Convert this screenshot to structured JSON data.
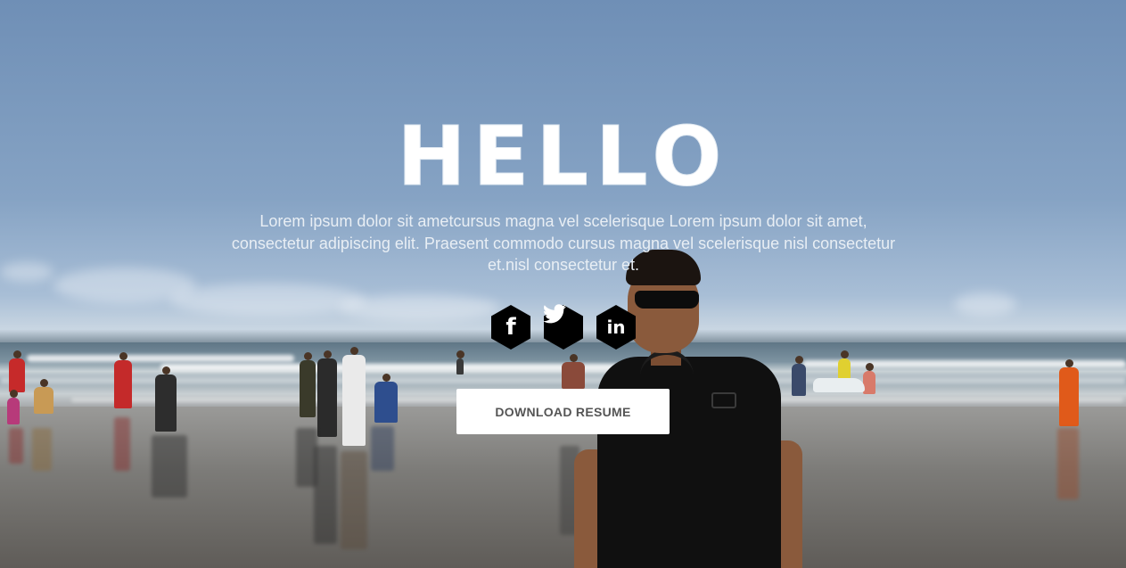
{
  "hero": {
    "heading": "HELLO",
    "intro_text": "Lorem ipsum dolor sit ametcursus magna vel scelerisque Lorem ipsum dolor sit amet, consectetur adipiscing elit. Praesent commodo cursus magna vel scelerisque nisl consectetur et.nisl consectetur et.",
    "download_button_label": "DOWNLOAD RESUME"
  },
  "social": [
    {
      "name": "facebook",
      "icon": "facebook-icon",
      "glyph": "f"
    },
    {
      "name": "twitter",
      "icon": "twitter-icon",
      "glyph": ""
    },
    {
      "name": "linkedin",
      "icon": "linkedin-icon",
      "glyph": "in"
    }
  ],
  "colors": {
    "icon_background": "#000000",
    "button_background": "#ffffff",
    "button_text": "#555555",
    "heading": "#ffffff"
  }
}
